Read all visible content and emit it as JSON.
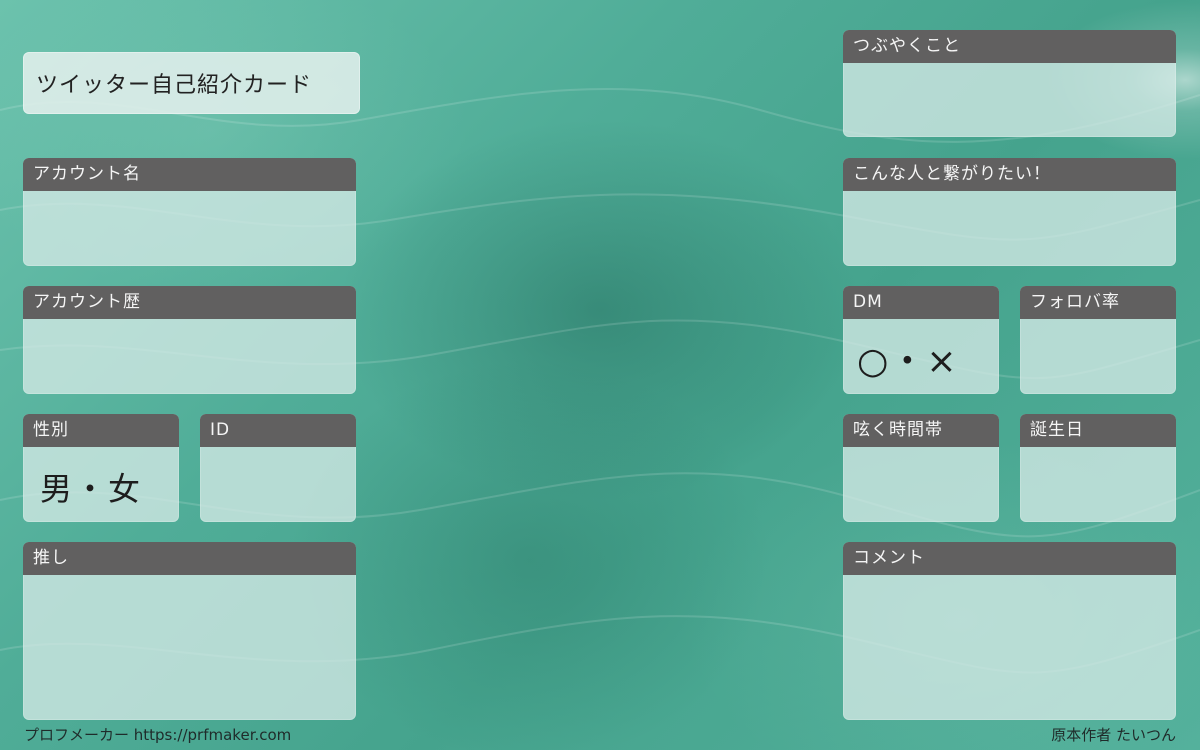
{
  "title": "ツイッター自己紹介カード",
  "cards": {
    "account_name": {
      "label": "アカウント名"
    },
    "account_history": {
      "label": "アカウント歴"
    },
    "gender": {
      "label": "性別",
      "value": "男・女"
    },
    "id": {
      "label": "ID"
    },
    "oshi": {
      "label": "推し"
    },
    "tweets_about": {
      "label": "つぶやくこと"
    },
    "want_to_connect": {
      "label": "こんな人と繋がりたい！"
    },
    "dm": {
      "label": "DM",
      "value": "○・×"
    },
    "follow_back_rate": {
      "label": "フォロバ率"
    },
    "tweet_time": {
      "label": "呟く時間帯"
    },
    "birthday": {
      "label": "誕生日"
    },
    "comment": {
      "label": "コメント"
    }
  },
  "footer": {
    "left": "プロフメーカー https://prfmaker.com",
    "right": "原本作者 たいつん"
  },
  "colors": {
    "header_bg": "#616060",
    "card_bg": "#d4e9e5",
    "water_base": "#50ad98"
  }
}
